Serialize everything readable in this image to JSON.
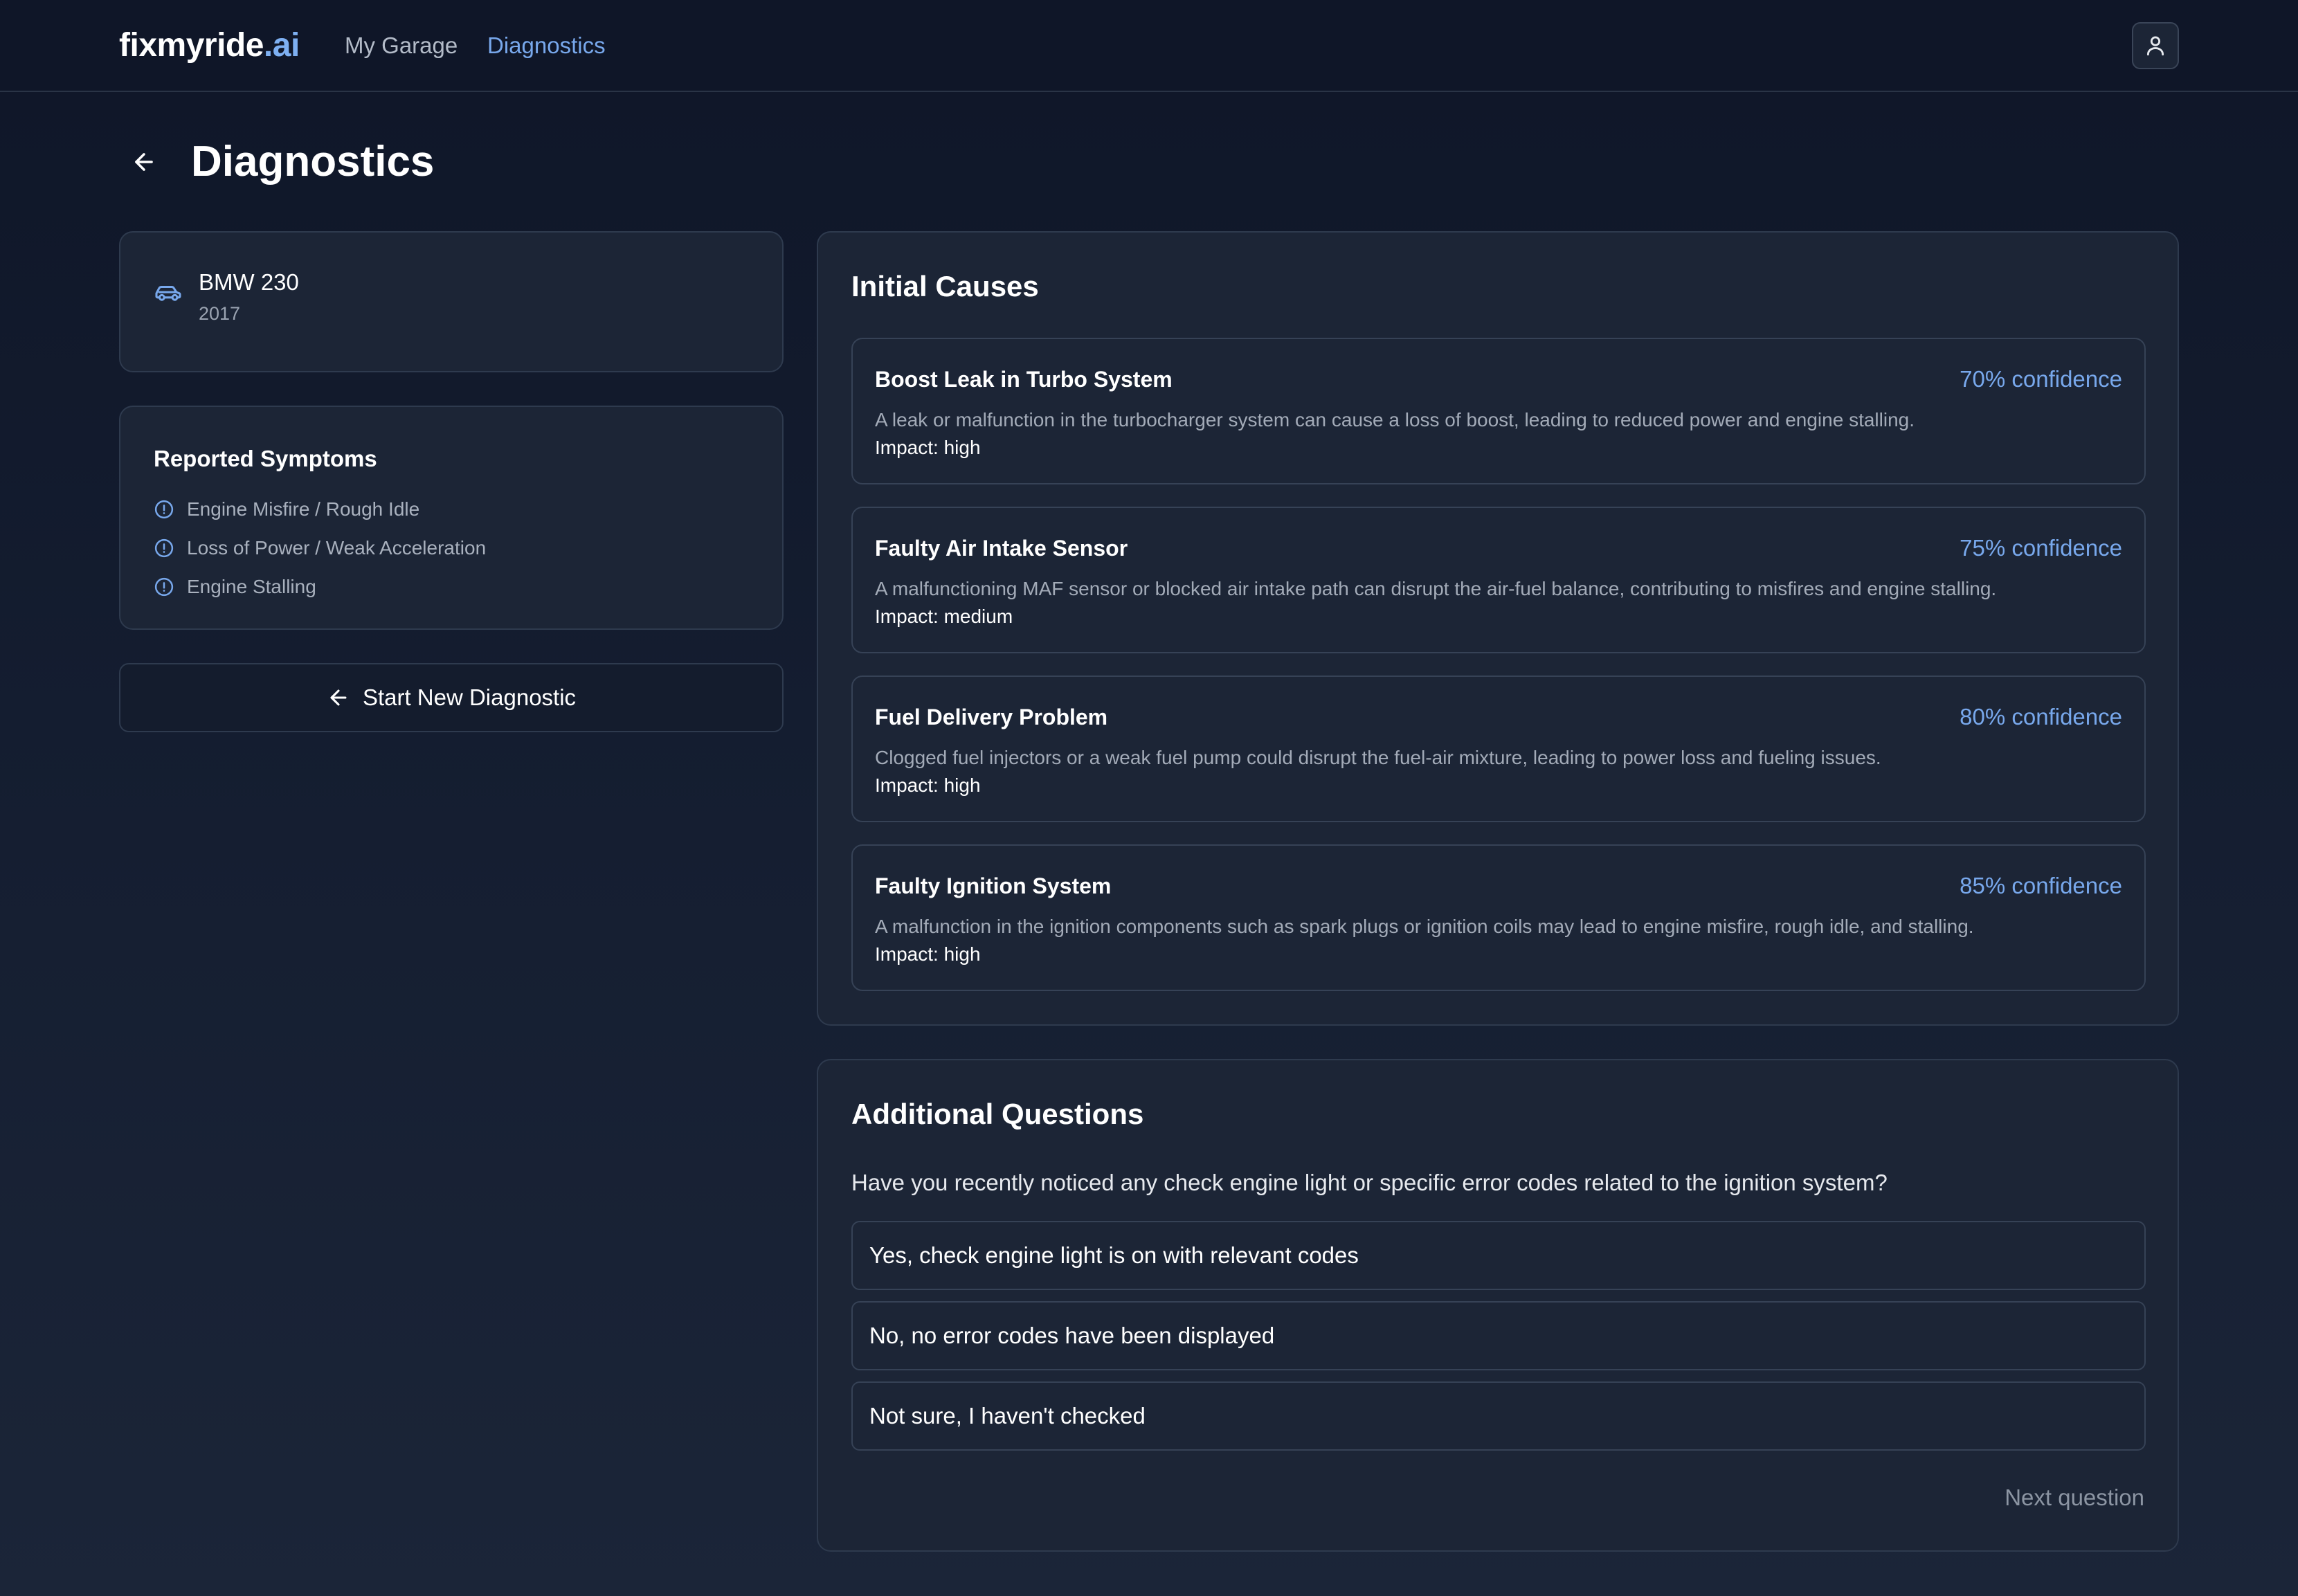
{
  "header": {
    "logo_main": "fixmyride",
    "logo_accent": ".ai",
    "nav": [
      {
        "label": "My Garage",
        "active": false
      },
      {
        "label": "Diagnostics",
        "active": true
      }
    ],
    "user_icon": "user-icon"
  },
  "page": {
    "title": "Diagnostics",
    "back_icon": "arrow-left-icon"
  },
  "vehicle": {
    "icon": "car-icon",
    "name": "BMW 230",
    "year": "2017"
  },
  "symptoms": {
    "title": "Reported Symptoms",
    "icon": "alert-circle-icon",
    "items": [
      "Engine Misfire / Rough Idle",
      "Loss of Power / Weak Acceleration",
      "Engine Stalling"
    ]
  },
  "actions": {
    "start_new_label": "Start New Diagnostic",
    "start_new_icon": "arrow-left-icon"
  },
  "causes": {
    "title": "Initial Causes",
    "items": [
      {
        "title": "Boost Leak in Turbo System",
        "confidence": "70% confidence",
        "description": "A leak or malfunction in the turbocharger system can cause a loss of boost, leading to reduced power and engine stalling.",
        "impact": "Impact: high"
      },
      {
        "title": "Faulty Air Intake Sensor",
        "confidence": "75% confidence",
        "description": "A malfunctioning MAF sensor or blocked air intake path can disrupt the air-fuel balance, contributing to misfires and engine stalling.",
        "impact": "Impact: medium"
      },
      {
        "title": "Fuel Delivery Problem",
        "confidence": "80% confidence",
        "description": "Clogged fuel injectors or a weak fuel pump could disrupt the fuel-air mixture, leading to power loss and fueling issues.",
        "impact": "Impact: high"
      },
      {
        "title": "Faulty Ignition System",
        "confidence": "85% confidence",
        "description": "A malfunction in the ignition components such as spark plugs or ignition coils may lead to engine misfire, rough idle, and stalling.",
        "impact": "Impact: high"
      }
    ]
  },
  "questions": {
    "title": "Additional Questions",
    "question": "Have you recently noticed any check engine light or specific error codes related to the ignition system?",
    "options": [
      "Yes, check engine light is on with relevant codes",
      "No, no error codes have been displayed",
      "Not sure, I haven't checked"
    ],
    "next_label": "Next question"
  },
  "colors": {
    "accent": "#78a8ec",
    "background": "#0f1628",
    "card": "#1c2536",
    "border": "#2e3a4e"
  }
}
